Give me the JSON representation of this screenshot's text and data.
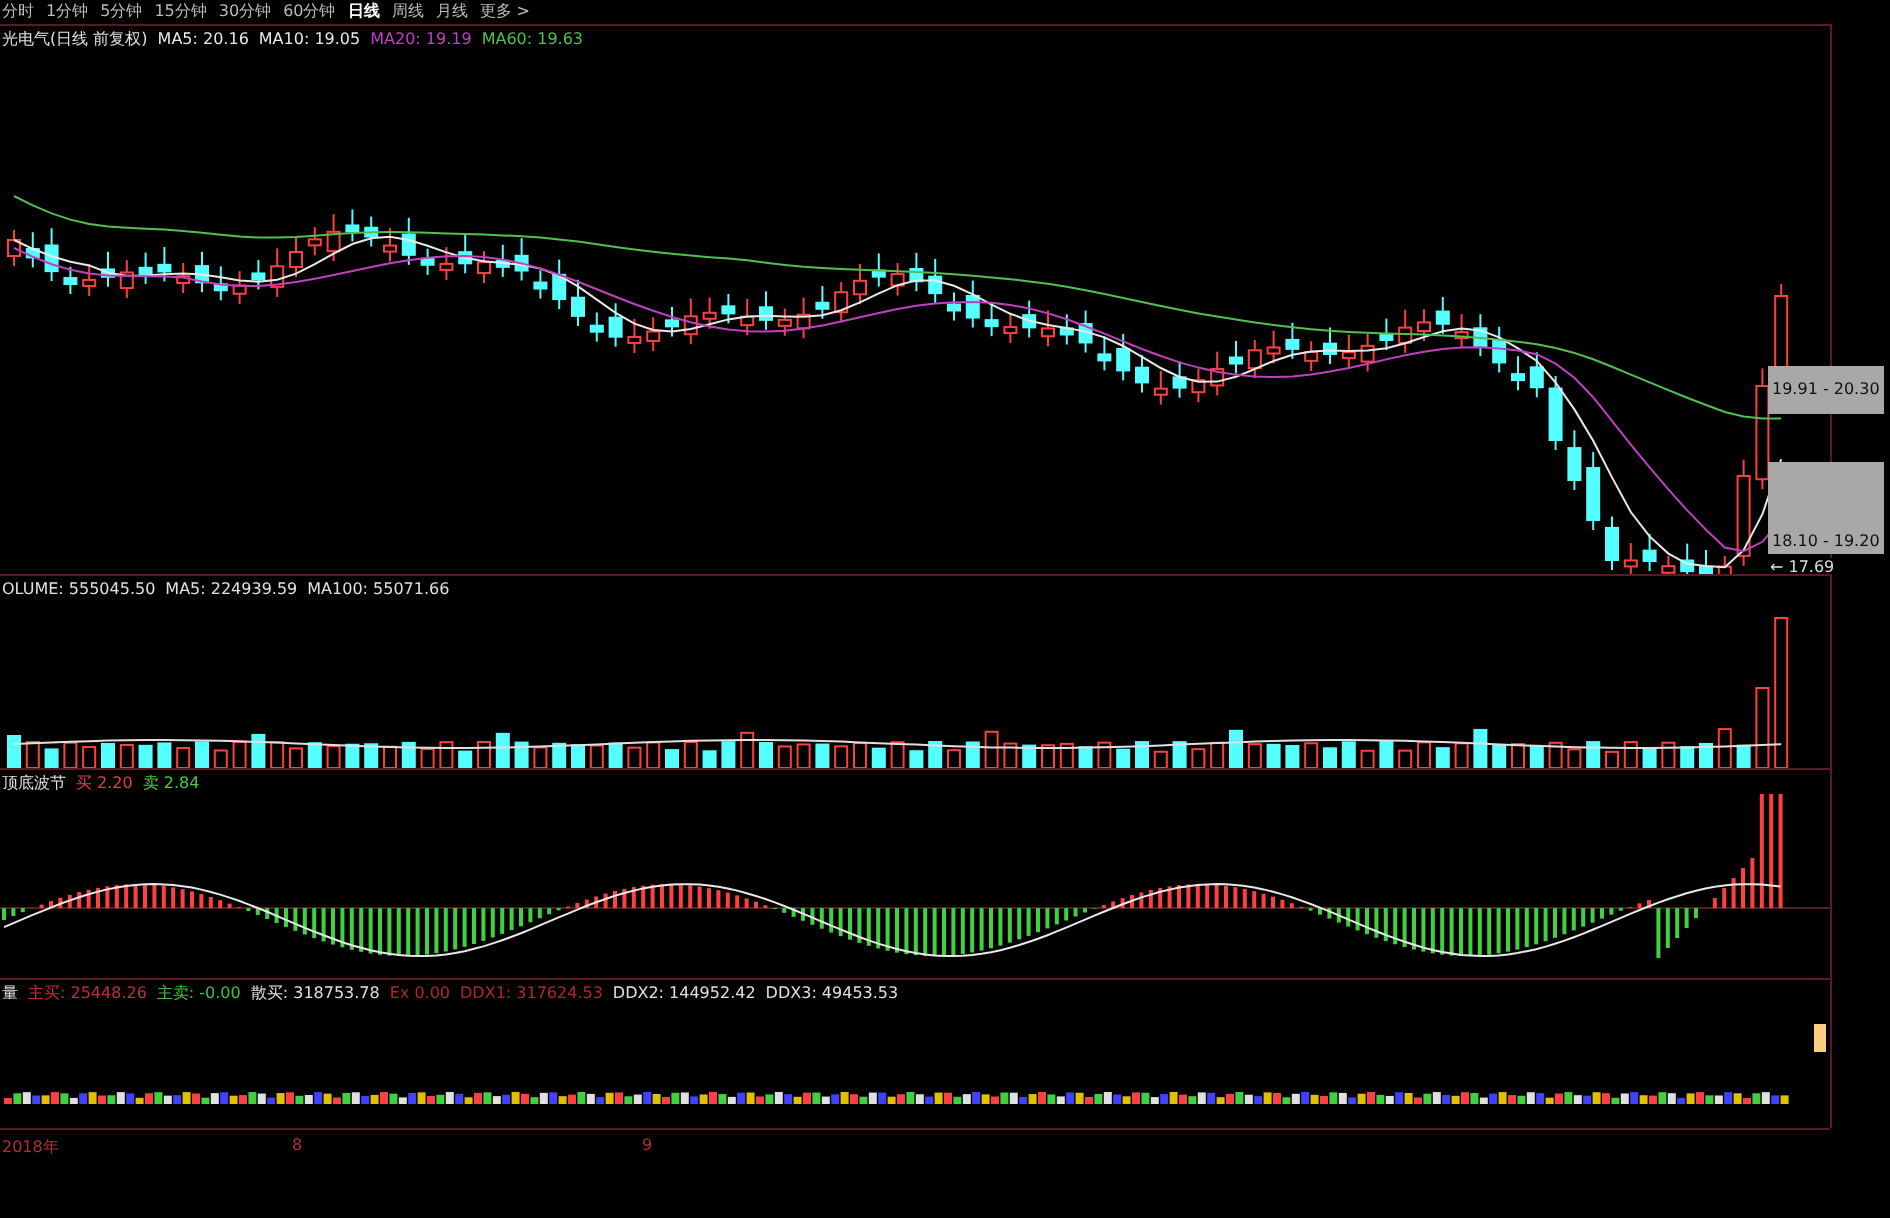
{
  "period_tabs": [
    {
      "label": "分时",
      "selected": false
    },
    {
      "label": "1分钟",
      "selected": false
    },
    {
      "label": "5分钟",
      "selected": false
    },
    {
      "label": "15分钟",
      "selected": false
    },
    {
      "label": "30分钟",
      "selected": false
    },
    {
      "label": "60分钟",
      "selected": false
    },
    {
      "label": "日线",
      "selected": true
    },
    {
      "label": "周线",
      "selected": false
    },
    {
      "label": "月线",
      "selected": false
    },
    {
      "label": "更多 >",
      "selected": false
    }
  ],
  "panels": [
    {
      "kind": "price",
      "title": "光电气(日线 前复权)",
      "readings": [
        {
          "text": "MA5: 20.16",
          "color": "#e8e8e8"
        },
        {
          "text": "MA10: 19.05",
          "color": "#e8e8e8"
        },
        {
          "text": "MA20: 19.19",
          "color": "#c040c0"
        },
        {
          "text": "MA60: 19.63",
          "color": "#50c050"
        }
      ],
      "range_labels": [
        "19.91 - 20.30",
        "18.10 - 19.20"
      ],
      "low_label": "← 17.69"
    },
    {
      "kind": "volume",
      "title": "OLUME: 555045.50",
      "readings": [
        {
          "text": "MA5: 224939.59",
          "color": "#e0e0e0"
        },
        {
          "text": "MA100: 55071.66",
          "color": "#e0e0e0"
        }
      ]
    },
    {
      "kind": "oscillator",
      "title": "顶底波节",
      "readings": [
        {
          "text": "买 2.20",
          "color": "#e04040"
        },
        {
          "text": "卖 2.84",
          "color": "#40d040"
        }
      ]
    },
    {
      "kind": "flow",
      "title": "量",
      "readings": [
        {
          "text": "主买: 25448.26",
          "color": "#c03030"
        },
        {
          "text": "主卖: -0.00",
          "color": "#40c040"
        },
        {
          "text": "散买: 318753.78",
          "color": "#e0e0e0"
        },
        {
          "text": "Ex 0.00",
          "color": "#b02828"
        },
        {
          "text": "DDX1: 317624.53",
          "color": "#b02828"
        },
        {
          "text": "DDX2: 144952.42",
          "color": "#e0e0e0"
        },
        {
          "text": "DDX3: 49453.53",
          "color": "#e0e0e0"
        }
      ]
    }
  ],
  "date_axis": {
    "labels": [
      "2018年",
      "8",
      "9"
    ]
  }
}
